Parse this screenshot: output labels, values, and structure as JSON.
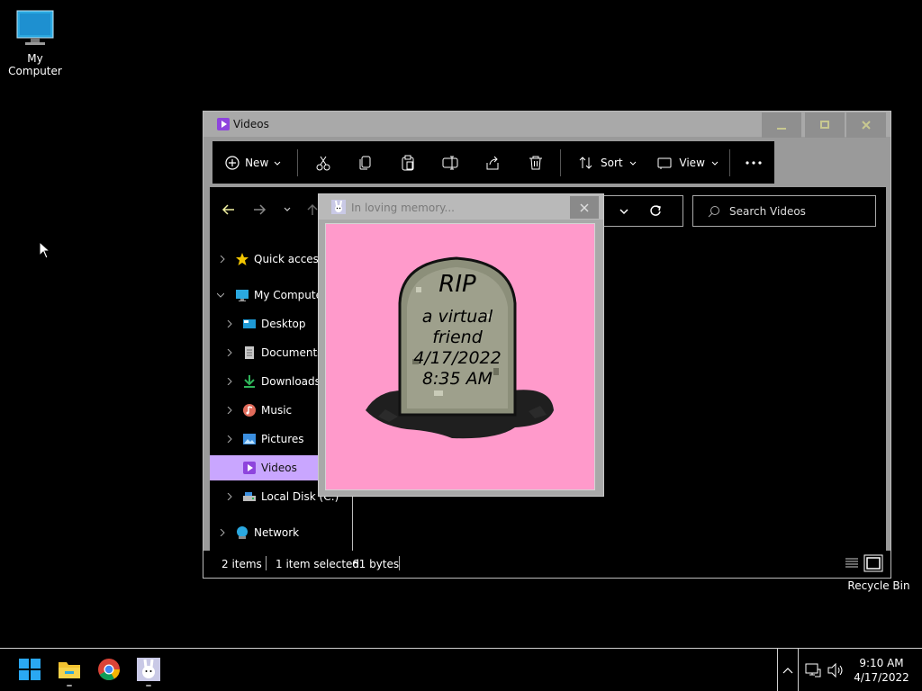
{
  "desktop": {
    "my_computer_label": "My Computer",
    "recycle_bin_label": "Recycle Bin"
  },
  "explorer": {
    "title": "Videos",
    "toolbar": {
      "new_label": "New",
      "sort_label": "Sort",
      "view_label": "View"
    },
    "search_placeholder": "Search Videos",
    "tree": [
      {
        "label": "Quick access",
        "icon": "star-icon"
      },
      {
        "label": "My Computer",
        "icon": "monitor-icon"
      },
      {
        "label": "Desktop",
        "icon": "desktop-folder-icon"
      },
      {
        "label": "Documents",
        "icon": "documents-icon"
      },
      {
        "label": "Downloads",
        "icon": "download-icon"
      },
      {
        "label": "Music",
        "icon": "music-icon"
      },
      {
        "label": "Pictures",
        "icon": "pictures-icon"
      },
      {
        "label": "Videos",
        "icon": "videos-icon"
      },
      {
        "label": "Local Disk (C:)",
        "icon": "disk-icon"
      },
      {
        "label": "Network",
        "icon": "network-icon"
      }
    ],
    "status": {
      "items": "2 items",
      "selected": "1 item selected",
      "size": "61 bytes"
    }
  },
  "popup": {
    "title": "In loving memory...",
    "tombstone": {
      "line1": "RIP",
      "line2": "a virtual",
      "line3": "friend",
      "line4": "4/17/2022",
      "line5": "8:35 AM"
    }
  },
  "taskbar": {
    "time": "9:10 AM",
    "date": "4/17/2022"
  },
  "colors": {
    "selection": "#c9a6ff",
    "popup_background": "#ff9acb",
    "window_chrome": "#9a9a9a"
  }
}
